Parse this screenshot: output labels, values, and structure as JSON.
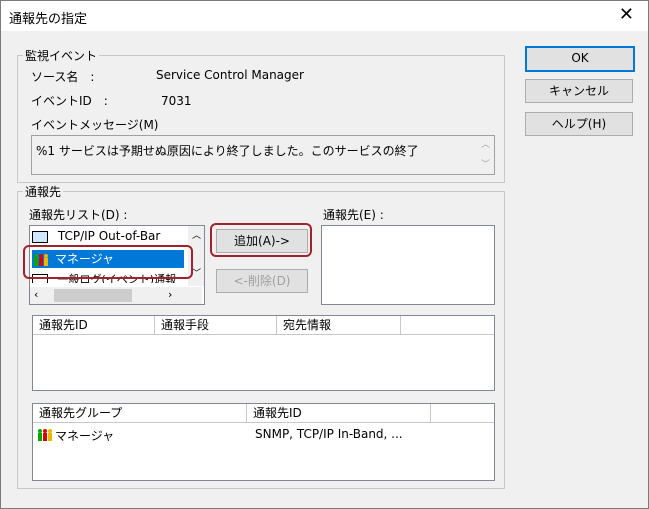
{
  "window": {
    "title": "通報先の指定",
    "close_glyph": "✕"
  },
  "buttons": {
    "ok": "OK",
    "cancel": "キャンセル",
    "help": "ヘルプ(H)"
  },
  "monitor_event": {
    "legend": "監視イベント",
    "source_label": "ソース名　:",
    "source_value": "Service Control Manager",
    "eventid_label": "イベントID　:",
    "eventid_value": "7031",
    "message_label": "イベントメッセージ(M)",
    "message_value": "%1 サービスは予期せぬ原因により終了しました。このサービスの終了"
  },
  "destination": {
    "legend": "通報先",
    "list_label": "通報先リスト(D) :",
    "list_items": [
      "TCP/IP Out-of-Bar",
      "マネージャ",
      "一般ログ(イベント)通報"
    ],
    "selected_index": 1,
    "add_button": "追加(A)->",
    "remove_button": "<-削除(D)",
    "dest_label": "通報先(E) :",
    "table1_headers": [
      "通報先ID",
      "通報手段",
      "宛先情報"
    ],
    "table2_headers": [
      "通報先グループ",
      "通報先ID"
    ],
    "table2_rows": [
      {
        "group": "マネージャ",
        "ids": "SNMP, TCP/IP In-Band, ..."
      }
    ]
  },
  "colors": {
    "selection": "#0078d7",
    "highlight": "#a0222c"
  }
}
